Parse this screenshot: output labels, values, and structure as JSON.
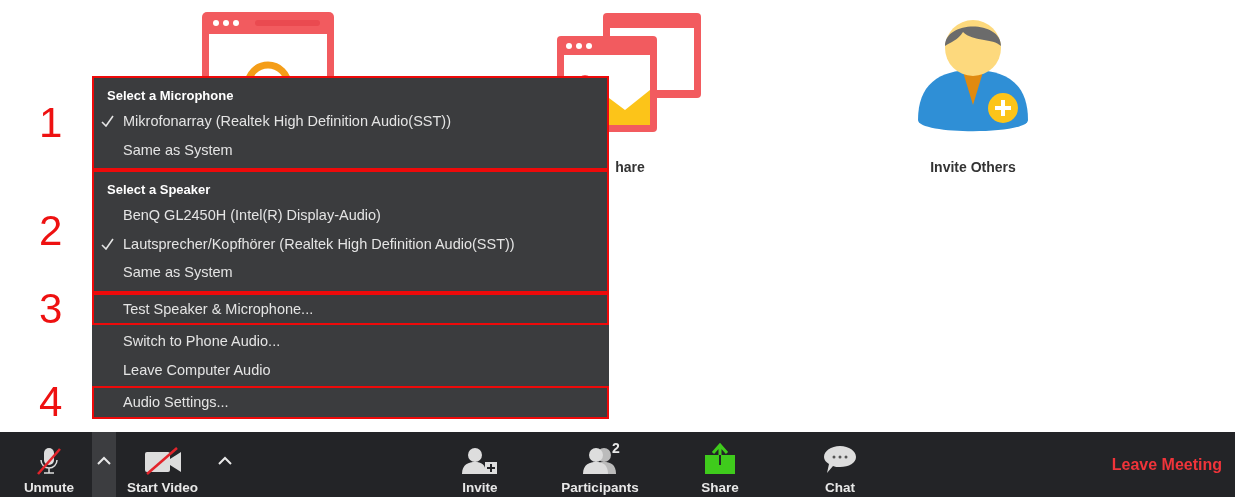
{
  "tiles": [
    {
      "kind": "audio"
    },
    {
      "kind": "share",
      "label": "hare"
    },
    {
      "kind": "invite",
      "label": "Invite Others"
    }
  ],
  "audio_menu": {
    "groups": [
      {
        "outlined": true,
        "annotation": "1",
        "rows": [
          {
            "kind": "header",
            "text": "Select a Microphone"
          },
          {
            "kind": "item",
            "text": "Mikrofonarray (Realtek High Definition Audio(SST))",
            "checked": true
          },
          {
            "kind": "item",
            "text": "Same as System",
            "checked": false
          }
        ]
      },
      {
        "outlined": true,
        "annotation": "2",
        "rows": [
          {
            "kind": "header",
            "text": "Select a Speaker"
          },
          {
            "kind": "item",
            "text": "BenQ GL2450H (Intel(R) Display-Audio)",
            "checked": false
          },
          {
            "kind": "item",
            "text": "Lautsprecher/Kopfhörer (Realtek High Definition Audio(SST))",
            "checked": true
          },
          {
            "kind": "item",
            "text": "Same as System",
            "checked": false
          }
        ]
      },
      {
        "outlined": true,
        "annotation": "3",
        "rows": [
          {
            "kind": "item",
            "text": "Test Speaker & Microphone...",
            "checked": false
          }
        ]
      },
      {
        "outlined": false,
        "rows": [
          {
            "kind": "item",
            "text": "Switch to Phone Audio...",
            "checked": false
          },
          {
            "kind": "item",
            "text": "Leave Computer Audio",
            "checked": false
          }
        ]
      },
      {
        "outlined": true,
        "annotation": "4",
        "rows": [
          {
            "kind": "item",
            "text": "Audio Settings...",
            "checked": false
          }
        ]
      }
    ]
  },
  "toolbar": {
    "left": [
      {
        "kind": "mic",
        "label": "Unmute"
      },
      {
        "kind": "caret",
        "active": true
      },
      {
        "kind": "video",
        "label": "Start Video"
      },
      {
        "kind": "caret",
        "active": false
      }
    ],
    "center": [
      {
        "kind": "invite",
        "label": "Invite"
      },
      {
        "kind": "participants",
        "label": "Participants",
        "count": "2"
      },
      {
        "kind": "share",
        "label": "Share"
      },
      {
        "kind": "chat",
        "label": "Chat"
      }
    ],
    "leave": {
      "label": "Leave Meeting"
    }
  }
}
